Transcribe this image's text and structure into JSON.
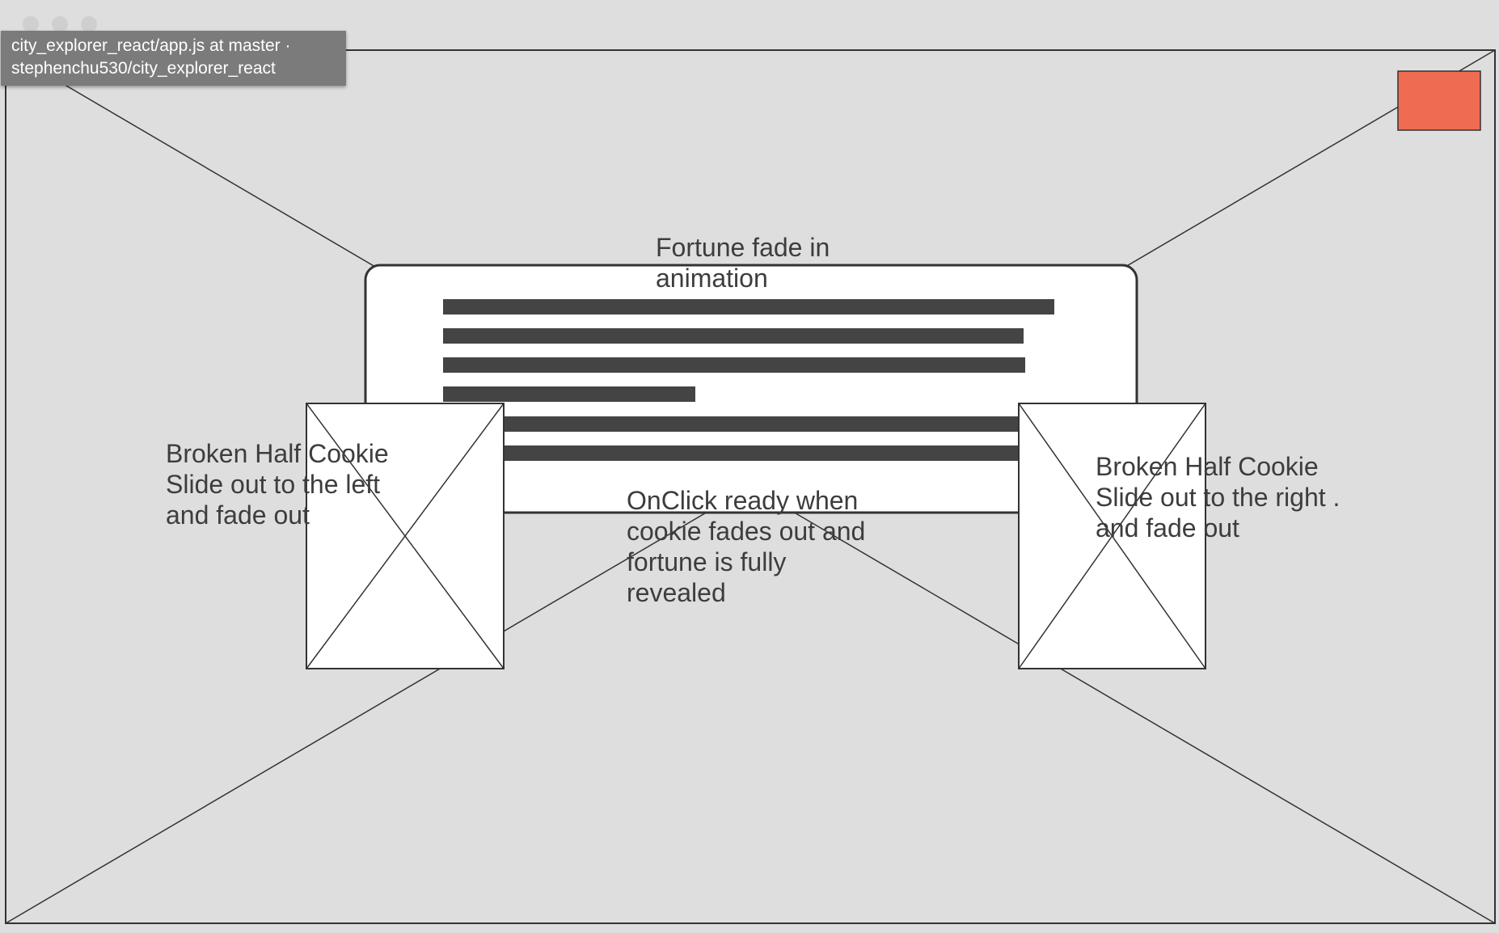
{
  "tooltip": {
    "line1": "city_explorer_react/app.js at master ·",
    "line2": "stephenchu530/city_explorer_react"
  },
  "notes": {
    "fortune": [
      "Fortune fade in",
      "animation"
    ],
    "left_cookie": [
      "Broken Half Cookie",
      "Slide out to the left",
      "and fade out"
    ],
    "right_cookie": [
      "Broken Half Cookie",
      "Slide out to the right .",
      "and fade out"
    ],
    "onclick": [
      "OnClick ready when",
      "cookie fades out and",
      "fortune is fully",
      "revealed"
    ]
  },
  "colors": {
    "background": "#dedede",
    "stroke": "#333333",
    "text": "#3d3d3d",
    "text_bar": "#444444",
    "accent_box": "#ef6b52",
    "panel": "#ffffff",
    "tooltip_bg": "#7b7b7b"
  },
  "icons": {
    "image_placeholder": "image-placeholder-icon",
    "window_controls": "traffic-light-icon"
  }
}
